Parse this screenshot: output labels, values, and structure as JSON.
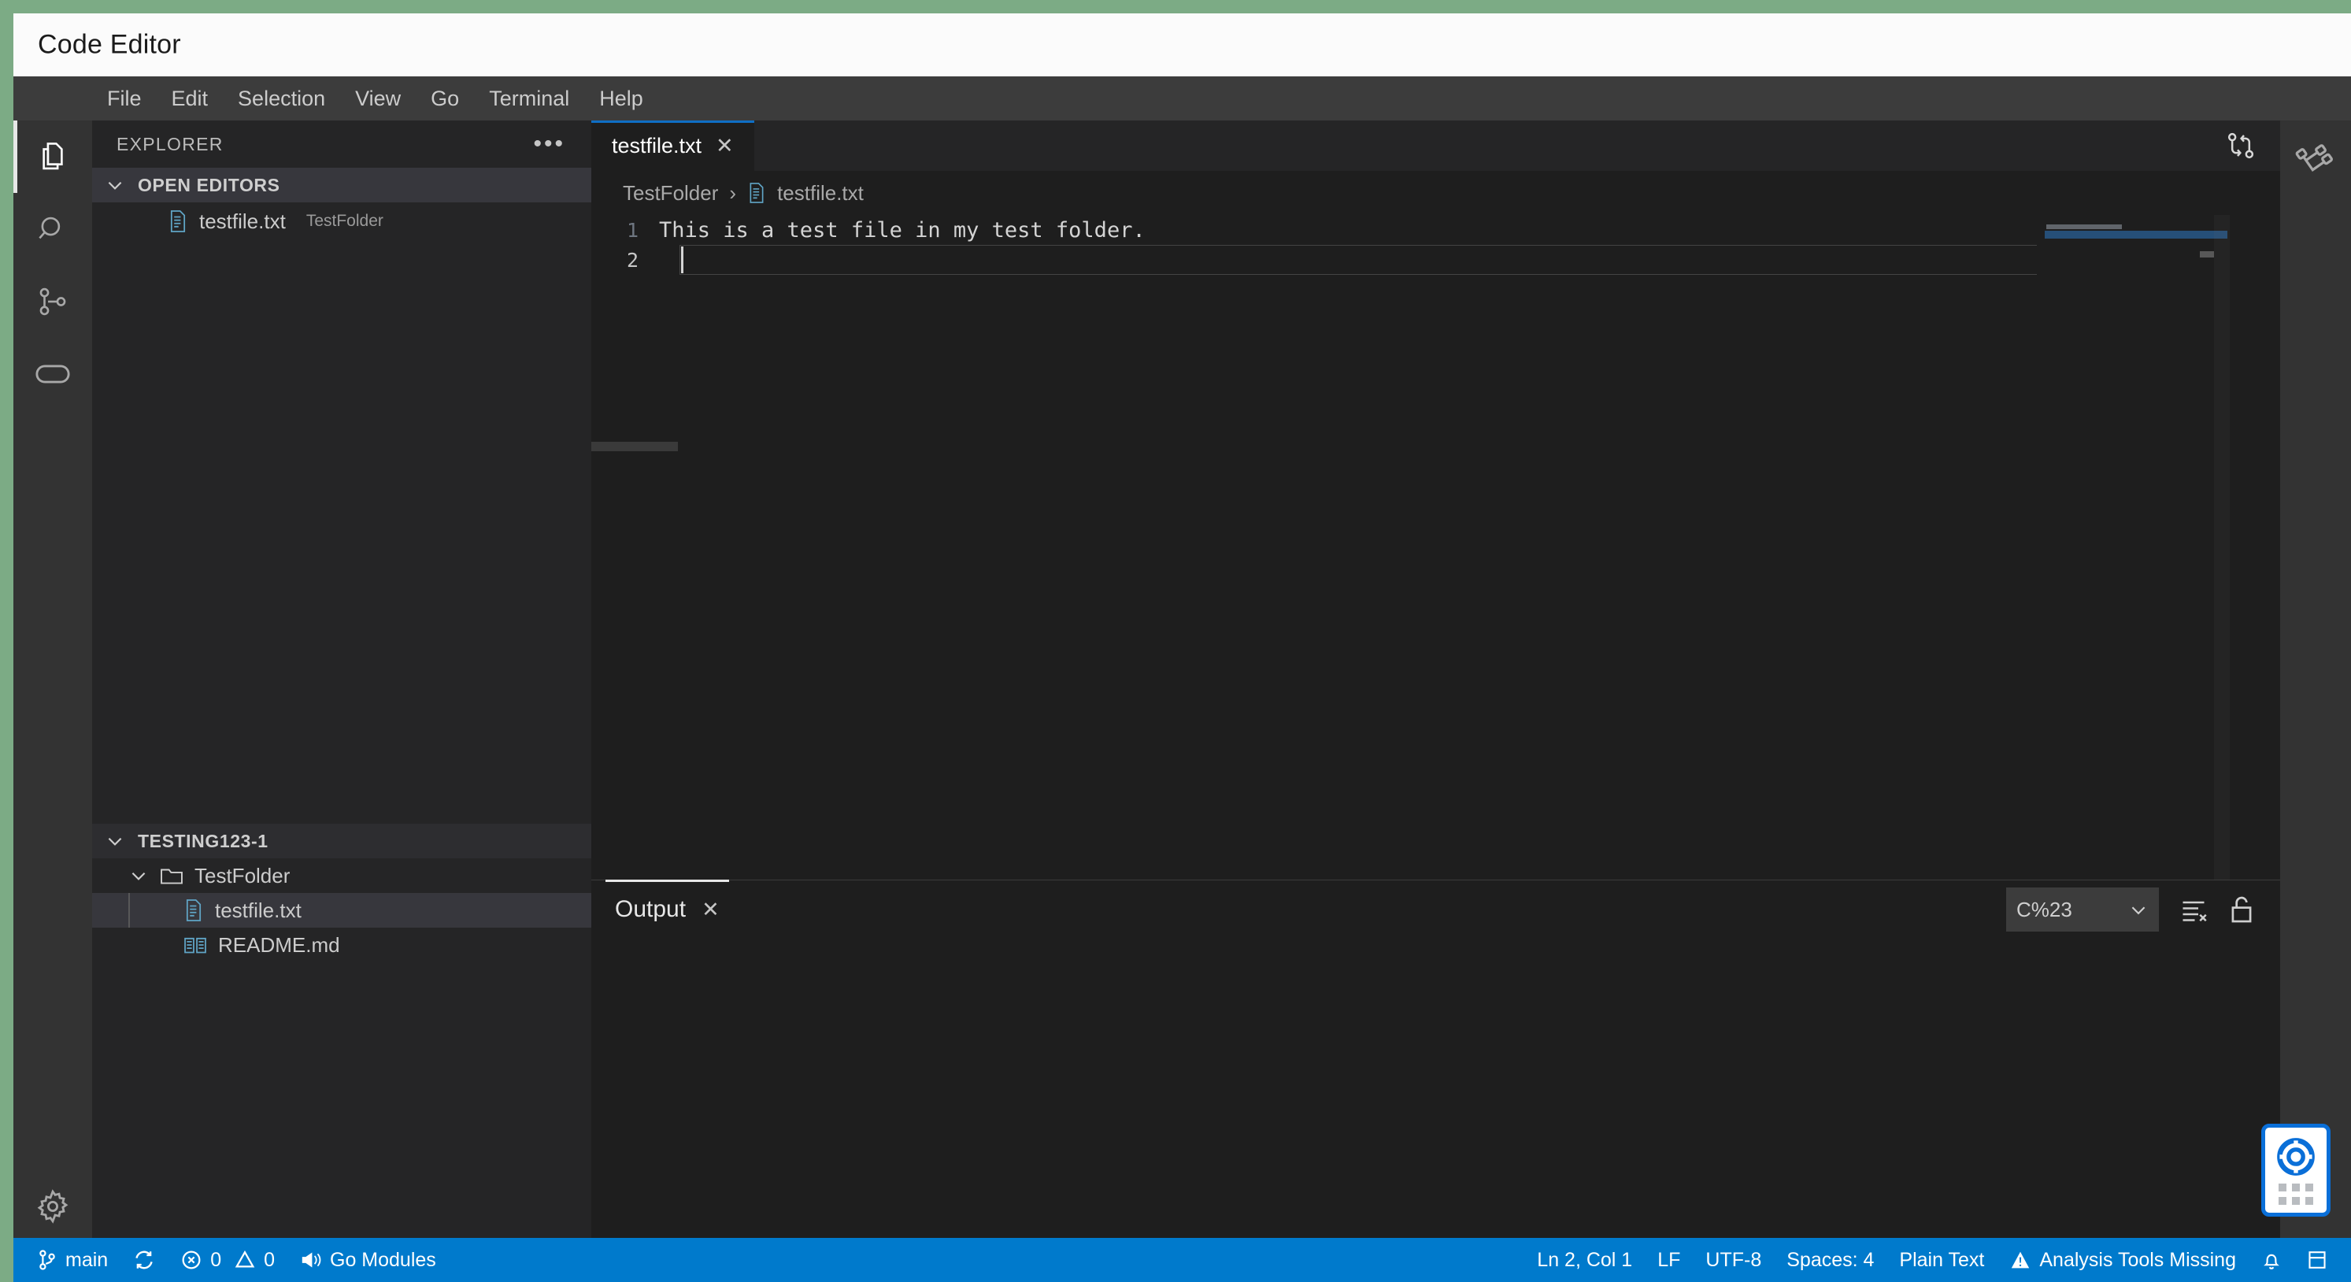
{
  "window": {
    "title": "Code Editor"
  },
  "menubar": {
    "items": [
      {
        "label": "File"
      },
      {
        "label": "Edit"
      },
      {
        "label": "Selection"
      },
      {
        "label": "View"
      },
      {
        "label": "Go"
      },
      {
        "label": "Terminal"
      },
      {
        "label": "Help"
      }
    ]
  },
  "activitybar": {
    "items": [
      {
        "name": "explorer",
        "icon": "files-icon",
        "active": true
      },
      {
        "name": "search",
        "icon": "search-icon",
        "active": false
      },
      {
        "name": "source-control",
        "icon": "source-control-icon",
        "active": false
      },
      {
        "name": "run-and-debug",
        "icon": "capsule-icon",
        "active": false
      }
    ],
    "bottom": [
      {
        "name": "manage",
        "icon": "gear-icon"
      }
    ]
  },
  "right_activitybar": {
    "items": [
      {
        "name": "source-control-graph",
        "icon": "source-control-rotated-icon"
      }
    ]
  },
  "sidebar": {
    "title": "EXPLORER",
    "more_label": "•••",
    "sections": [
      {
        "label": "OPEN EDITORS",
        "expanded": true
      },
      {
        "label": "TESTING123-1",
        "expanded": true
      }
    ],
    "open_editors": [
      {
        "name": "testfile.txt",
        "folder": "TestFolder",
        "icon": "text-file-icon"
      }
    ],
    "tree": [
      {
        "name": "TestFolder",
        "type": "folder",
        "depth": 0,
        "expanded": true,
        "selected": false,
        "icon": "folder-icon"
      },
      {
        "name": "testfile.txt",
        "type": "file",
        "depth": 1,
        "expanded": false,
        "selected": true,
        "icon": "text-file-icon"
      },
      {
        "name": "README.md",
        "type": "file",
        "depth": 0,
        "expanded": false,
        "selected": false,
        "icon": "markdown-icon"
      }
    ]
  },
  "editor": {
    "tabs": [
      {
        "label": "testfile.txt",
        "active": true,
        "close_label": "✕"
      }
    ],
    "toolbar": [
      {
        "name": "compare-changes",
        "icon": "compare-changes-icon"
      }
    ],
    "breadcrumb": [
      {
        "label": "TestFolder",
        "icon": ""
      },
      {
        "label": "testfile.txt",
        "icon": "text-file-icon"
      }
    ],
    "breadcrumb_separator": "›",
    "lines": [
      {
        "number": "1",
        "text": "This is a test file in my test folder."
      },
      {
        "number": "2",
        "text": ""
      }
    ],
    "active_line": "2"
  },
  "panel": {
    "tabs": [
      {
        "label": "Output",
        "active": true,
        "close_label": "✕"
      }
    ],
    "output_channel": "C%23",
    "chevron": "⌄",
    "actions": [
      {
        "name": "clear-output",
        "icon": "clear-output-icon"
      },
      {
        "name": "unlock-scroll",
        "icon": "unlock-icon"
      }
    ],
    "body_text": ""
  },
  "statusbar": {
    "left": [
      {
        "name": "branch",
        "icon": "git-branch-icon",
        "label": "main"
      },
      {
        "name": "sync",
        "icon": "sync-icon",
        "label": ""
      },
      {
        "name": "problems",
        "icon": "error-warning-icon",
        "label": "0 0",
        "errors": "0",
        "warnings": "0"
      },
      {
        "name": "go-modules",
        "icon": "megaphone-icon",
        "label": "Go Modules"
      }
    ],
    "right": [
      {
        "name": "cursor-position",
        "label": "Ln 2, Col 1"
      },
      {
        "name": "line-endings",
        "label": "LF"
      },
      {
        "name": "encoding",
        "label": "UTF-8"
      },
      {
        "name": "indentation",
        "label": "Spaces: 4"
      },
      {
        "name": "language-mode",
        "label": "Plain Text"
      },
      {
        "name": "analysis-tools",
        "icon": "warning-icon",
        "label": "Analysis Tools Missing"
      },
      {
        "name": "notifications",
        "icon": "bell-icon",
        "label": ""
      },
      {
        "name": "layout",
        "icon": "layout-icon",
        "label": ""
      }
    ]
  },
  "help_widget": {
    "name": "help-lifering",
    "icon": "lifering-icon"
  },
  "colors": {
    "accent_blue": "#007acc",
    "tab_active_border": "#0f6fc5",
    "frame_green": "#7cab85",
    "editor_bg": "#1e1e1e",
    "sidebar_bg": "#252526",
    "activitybar_bg": "#333333",
    "menubar_bg": "#3c3c3c",
    "help_blue": "#0a6fd8"
  }
}
